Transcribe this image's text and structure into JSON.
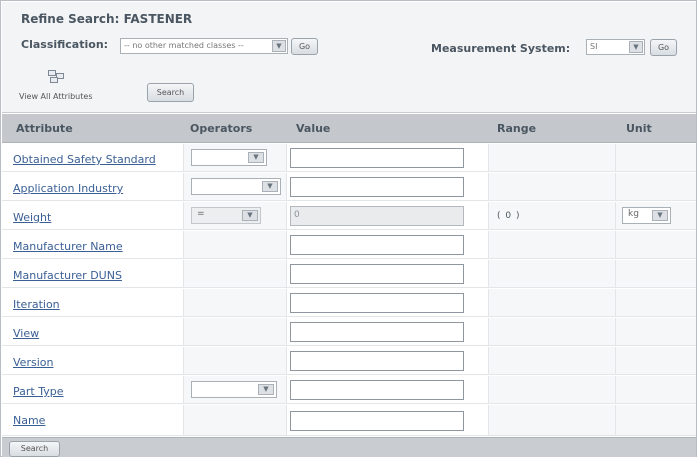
{
  "header": {
    "title": "Refine Search: FASTENER",
    "classification_label": "Classification:",
    "classification_value": "-- no other matched classes --",
    "go_label": "Go",
    "measurement_label": "Measurement System:",
    "measurement_value": "SI",
    "view_all_label": "View All Attributes",
    "search_label": "Search"
  },
  "table": {
    "headers": [
      "Attribute",
      "Operators",
      "Value",
      "Range",
      "Unit"
    ],
    "rows": [
      {
        "attribute": "Obtained Safety Standard",
        "operator": "",
        "value": "",
        "range": "",
        "unit": ""
      },
      {
        "attribute": "Application Industry",
        "operator": "",
        "value": "",
        "range": "",
        "unit": ""
      },
      {
        "attribute": "Weight",
        "operator": "=",
        "value": "0",
        "range": "( 0 )",
        "unit": "kg"
      },
      {
        "attribute": "Manufacturer Name",
        "value": ""
      },
      {
        "attribute": "Manufacturer DUNS",
        "value": ""
      },
      {
        "attribute": "Iteration",
        "value": ""
      },
      {
        "attribute": "View",
        "value": ""
      },
      {
        "attribute": "Version",
        "value": ""
      },
      {
        "attribute": "Part Type",
        "operator": "",
        "value": ""
      },
      {
        "attribute": "Name",
        "value": ""
      }
    ]
  },
  "footer": {
    "search_label": "Search"
  }
}
